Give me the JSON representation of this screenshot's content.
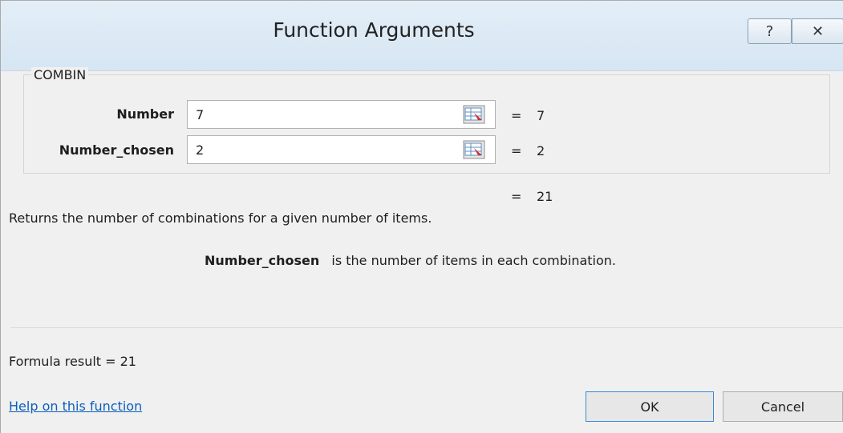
{
  "window": {
    "title": "Function Arguments",
    "help_glyph": "?",
    "close_glyph": "✕"
  },
  "function_group": {
    "name": "COMBIN",
    "arguments": [
      {
        "label": "Number",
        "value": "7",
        "eq": "=",
        "result": "7"
      },
      {
        "label": "Number_chosen",
        "value": "2",
        "eq": "=",
        "result": "2"
      }
    ]
  },
  "overall": {
    "eq": "=",
    "result": "21"
  },
  "description": "Returns the number of combinations for a given number of items.",
  "argument_help": {
    "name": "Number_chosen",
    "text": "is the number of items in each combination."
  },
  "footer": {
    "formula_result": "Formula result =   21",
    "help_link": "Help on this function",
    "ok_label": "OK",
    "cancel_label": "Cancel"
  },
  "colors": {
    "link": "#0b5fbf",
    "ok_border": "#3b89d6",
    "dialog_bg": "#f0f0f0"
  }
}
